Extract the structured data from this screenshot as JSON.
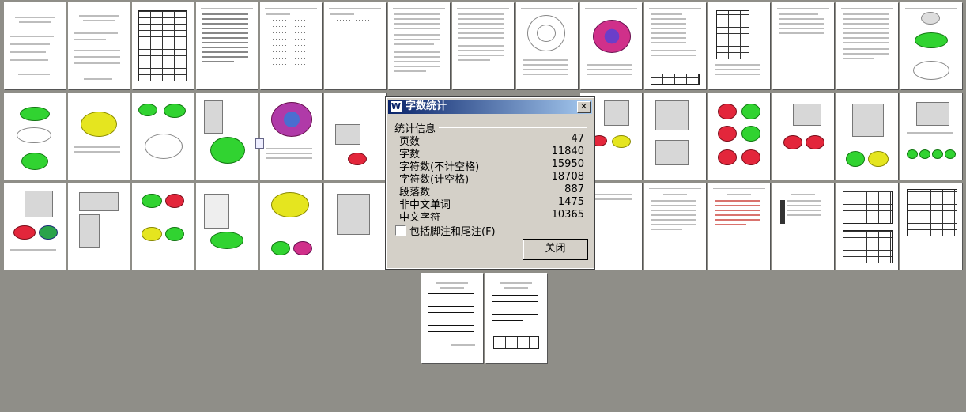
{
  "dialog": {
    "title": "字数统计",
    "title_icon": "W",
    "close_glyph": "✕",
    "section": "统计信息",
    "stats": [
      {
        "label": "页数",
        "value": "47"
      },
      {
        "label": "字数",
        "value": "11840"
      },
      {
        "label": "字符数(不计空格)",
        "value": "15950"
      },
      {
        "label": "字符数(计空格)",
        "value": "18708"
      },
      {
        "label": "段落数",
        "value": "887"
      },
      {
        "label": "非中文单词",
        "value": "1475"
      },
      {
        "label": "中文字符",
        "value": "10365"
      }
    ],
    "checkbox_label": "包括脚注和尾注(F)",
    "close_button": "关闭"
  },
  "colors": {
    "workspace": "#8f8e88",
    "titlebar_start": "#0a246a",
    "titlebar_end": "#a6caf0",
    "dialog_face": "#d4d0c8"
  },
  "icons": [
    "word-app-icon",
    "close-icon",
    "checkbox-icon"
  ]
}
